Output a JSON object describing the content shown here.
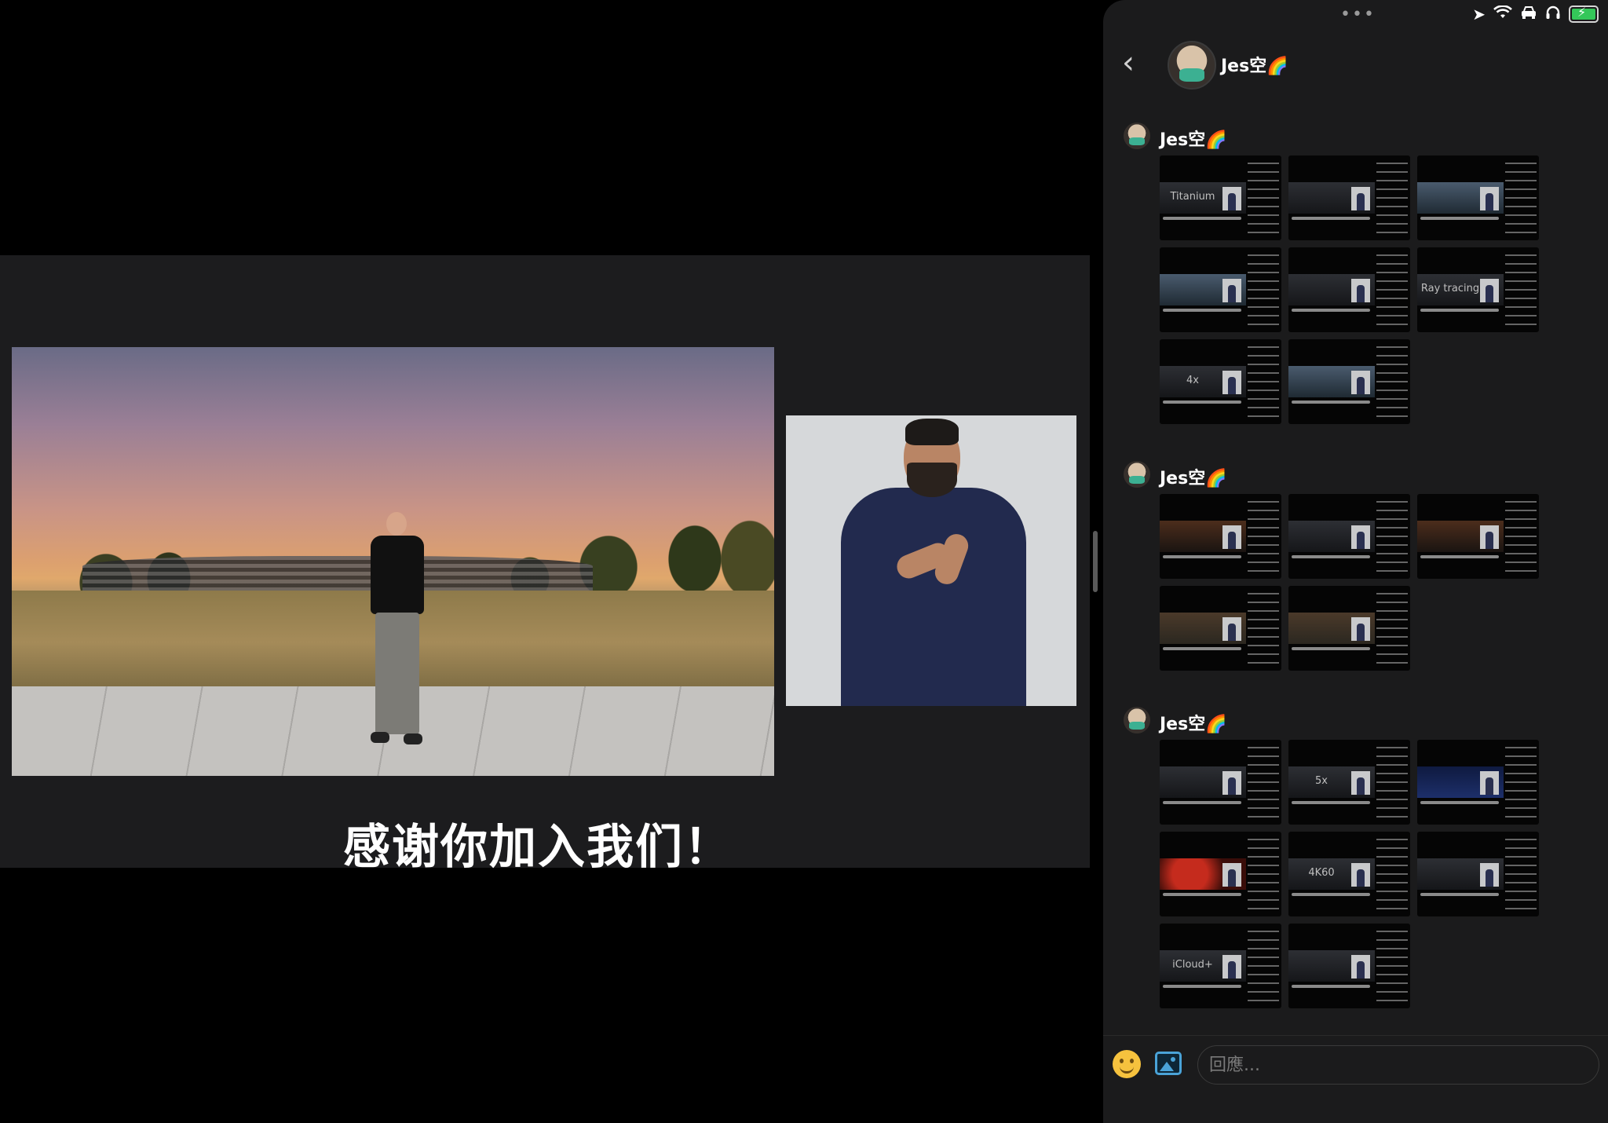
{
  "video": {
    "subtitle": "感谢你加入我们！"
  },
  "status_bar": {
    "more": "•••",
    "icons": [
      "location-arrow-icon",
      "wifi-icon",
      "car-icon",
      "headphones-icon",
      "battery-charging-icon"
    ],
    "battery_color": "#34c759"
  },
  "chat": {
    "back_label": "‹",
    "contact_name": "Jes空🌈",
    "messages": [
      {
        "sender": "Jes空🌈",
        "thumbnails": [
          {
            "caption": "Titanium",
            "variant": "gray"
          },
          {
            "caption": "",
            "variant": "gray"
          },
          {
            "caption": "",
            "variant": "bright"
          },
          {
            "caption": "",
            "variant": "bright"
          },
          {
            "caption": "",
            "variant": "gray"
          },
          {
            "caption": "Ray tracing",
            "variant": "gray"
          },
          {
            "caption": "4x",
            "variant": "gray"
          },
          {
            "caption": "",
            "variant": "bright"
          }
        ]
      },
      {
        "sender": "Jes空🌈",
        "thumbnails": [
          {
            "caption": "",
            "variant": "warm"
          },
          {
            "caption": "",
            "variant": "gray"
          },
          {
            "caption": "",
            "variant": "warm"
          },
          {
            "caption": "",
            "variant": "forest"
          },
          {
            "caption": "",
            "variant": "forest"
          }
        ]
      },
      {
        "sender": "Jes空🌈",
        "thumbnails": [
          {
            "caption": "",
            "variant": "gray"
          },
          {
            "caption": "5x",
            "variant": "gray"
          },
          {
            "caption": "",
            "variant": "blue"
          },
          {
            "caption": "",
            "variant": "red"
          },
          {
            "caption": "4K60",
            "variant": "gray"
          },
          {
            "caption": "",
            "variant": "gray"
          },
          {
            "caption": "iCloud+",
            "variant": "gray"
          },
          {
            "caption": "",
            "variant": "gray"
          }
        ]
      }
    ],
    "composer": {
      "placeholder": "回應..."
    }
  }
}
